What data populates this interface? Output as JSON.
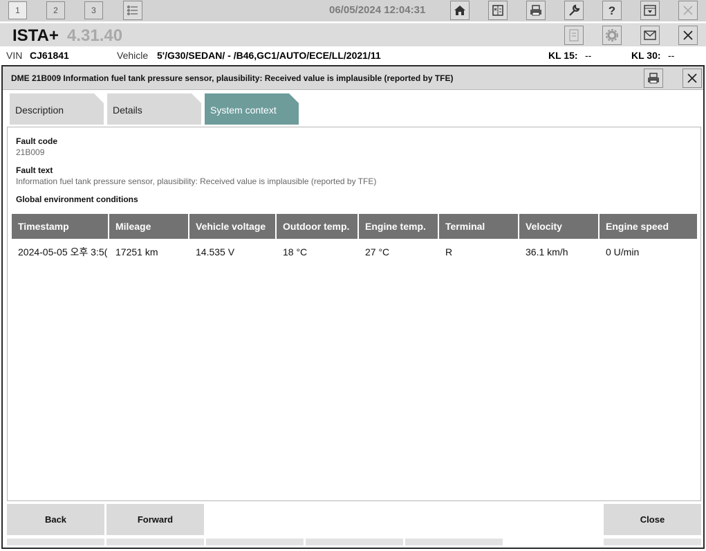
{
  "topbar": {
    "tabs": [
      "1",
      "2",
      "3"
    ],
    "datetime": "06/05/2024 12:04:31",
    "icons": [
      "list-icon",
      "home-icon",
      "vehicle-compare-icon",
      "print-icon",
      "wrench-icon",
      "help-icon",
      "download-icon",
      "close-icon"
    ]
  },
  "titlebar": {
    "app_name": "ISTA+",
    "version": "4.31.40"
  },
  "vinbar": {
    "vin_label": "VIN",
    "vin": "CJ61841",
    "vehicle_label": "Vehicle",
    "vehicle": "5'/G30/SEDAN/ - /B46,GC1/AUTO/ECE/LL/2021/11",
    "kl15_label": "KL 15:",
    "kl15_value": "--",
    "kl30_label": "KL 30:",
    "kl30_value": "--"
  },
  "dialog": {
    "title": "DME 21B009 Information fuel tank pressure sensor, plausibility: Received value is implausible (reported by TFE)",
    "tabs": [
      {
        "label": "Description"
      },
      {
        "label": "Details"
      },
      {
        "label": "System context"
      }
    ],
    "fault_code_label": "Fault code",
    "fault_code": "21B009",
    "fault_text_label": "Fault text",
    "fault_text": "Information fuel tank pressure sensor, plausibility: Received value is implausible (reported by TFE)",
    "global_label": "Global environment conditions",
    "table": {
      "headers": [
        "Timestamp",
        "Mileage",
        "Vehicle voltage",
        "Outdoor temp.",
        "Engine temp.",
        "Terminal",
        "Velocity",
        "Engine speed"
      ],
      "row": [
        "2024-05-05 오후 3:5(",
        "17251 km",
        "14.535 V",
        "18 °C",
        "27 °C",
        "R",
        "36.1 km/h",
        "0 U/min"
      ]
    },
    "buttons": {
      "back": "Back",
      "forward": "Forward",
      "close": "Close"
    }
  },
  "colors": {
    "active_tab": "#6d9c9b",
    "table_header": "#727272",
    "toolbar_bg": "#d3d3d3"
  }
}
